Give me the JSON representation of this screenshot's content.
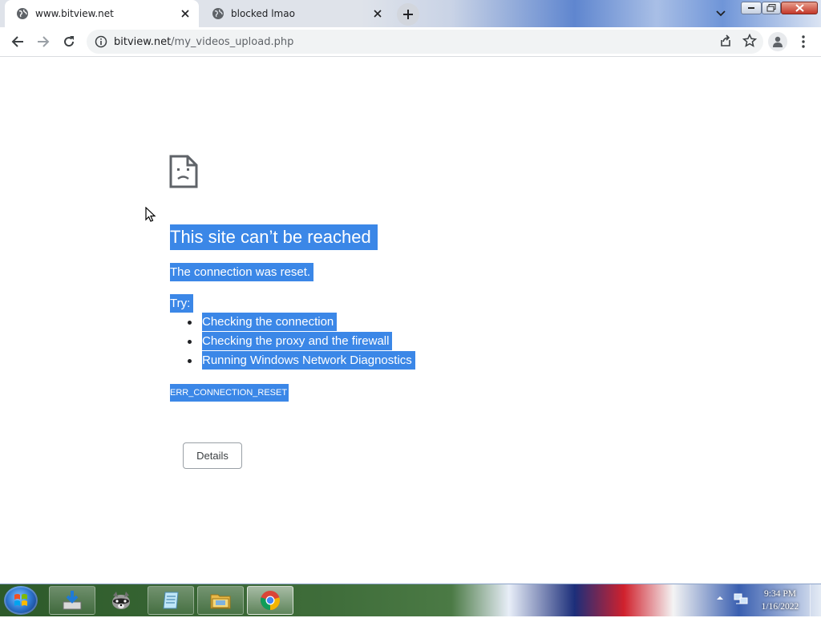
{
  "browser": {
    "tabs": [
      {
        "title": "www.bitview.net",
        "active": true,
        "favicon": "globe-icon"
      },
      {
        "title": "blocked lmao",
        "active": false,
        "favicon": "globe-icon"
      }
    ],
    "address_bar": {
      "host": "bitview.net",
      "path": "/my_videos_upload.php"
    }
  },
  "error_page": {
    "heading": "This site can’t be reached",
    "description": "The connection was reset.",
    "try_label": "Try:",
    "suggestions": [
      "Checking the connection",
      "Checking the proxy and the firewall",
      "Running Windows Network Diagnostics"
    ],
    "error_code": "ERR_CONNECTION_RESET",
    "details_button": "Details",
    "selection_color": "#3b87e7"
  },
  "taskbar": {
    "time": "9:34 PM",
    "date": "1/16/2022",
    "pinned": [
      "download-manager-icon",
      "raccoon-app-icon",
      "notepad-icon",
      "file-explorer-icon",
      "chrome-icon"
    ]
  }
}
